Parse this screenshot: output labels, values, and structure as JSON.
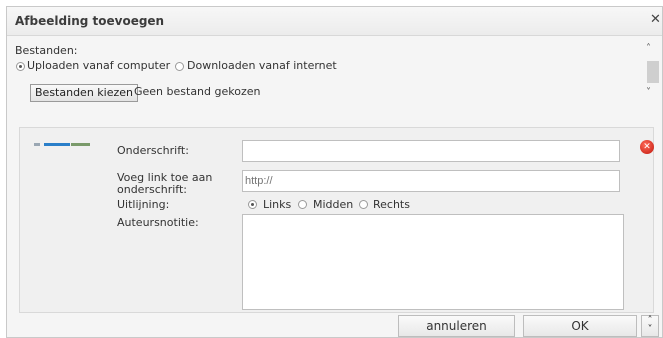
{
  "dialog": {
    "title": "Afbeelding toevoegen",
    "close_icon": "close-icon"
  },
  "upload": {
    "files_label": "Bestanden:",
    "option_computer": "Uploaden vanaf computer",
    "option_internet": "Downloaden vanaf internet",
    "choose_button": "Bestanden kiezen",
    "no_file": "Geen bestand gekozen"
  },
  "form": {
    "caption_label": "Onderschrift:",
    "caption_value": "",
    "link_label_1": "Voeg link toe aan",
    "link_label_2": "onderschrift:",
    "link_placeholder": "http://",
    "align_label": "Uitlijning:",
    "align_left": "Links",
    "align_center": "Midden",
    "align_right": "Rechts",
    "note_label": "Auteursnotitie:",
    "note_value": ""
  },
  "buttons": {
    "cancel": "annuleren",
    "ok": "OK"
  },
  "colors": {
    "remove": "#d42a1c",
    "accent": "#2a7fc9"
  }
}
